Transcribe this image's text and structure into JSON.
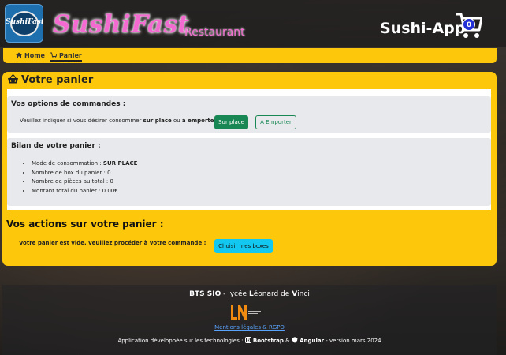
{
  "header": {
    "logo_text": "SushiFast",
    "brand_name": "SushiFast",
    "brand_subtitle": "Restaurant",
    "app_title": "Sushi-App",
    "cart_count": "0"
  },
  "nav": {
    "items": [
      {
        "label": "Home",
        "icon": "home-icon"
      },
      {
        "label": "Panier",
        "icon": "cart-icon",
        "active": true
      }
    ]
  },
  "main": {
    "title": "Votre panier",
    "options": {
      "heading": "Vos options de commandes :",
      "text_prefix": "Veuillez indiquer si vous désirer consommer ",
      "option_1": "sur place",
      "text_middle": " ou ",
      "option_2": "à emporter",
      "text_suffix": " :",
      "button_sur_place": "Sur place",
      "button_emporter": "A Emporter"
    },
    "bilan": {
      "heading": "Bilan de votre panier :",
      "mode_label": "Mode de consommation : ",
      "mode_value": "SUR PLACE",
      "box_line": "Nombre de box du panier : 0",
      "pieces_line": "Nombre de pièces au total : 0",
      "total_line": "Montant total du panier : 0.00€"
    },
    "actions": {
      "heading": "Vos actions sur votre panier :",
      "empty_text": "Votre panier est vide, veuillez procéder à votre commande :",
      "button_choose": "Choisir mes boxes"
    }
  },
  "footer": {
    "school_bold": "BTS SIO",
    "school_rest": " - lycée ",
    "school_name_L": "L",
    "school_name_1": "éonard de ",
    "school_name_V": "V",
    "school_name_2": "inci",
    "legal_link": "Mentions légales & RGPD",
    "credit_prefix": "Application développée sur les technologies : ",
    "tech_1": "Bootstrap",
    "credit_amp": " & ",
    "tech_2": "Angular",
    "credit_suffix": " - version mars 2024"
  },
  "colors": {
    "accent_yellow": "#fdc70b",
    "brand_pink": "#f36bd0",
    "button_green": "#198754",
    "button_cyan": "#13c8f0",
    "badge_blue": "#2330d6"
  }
}
